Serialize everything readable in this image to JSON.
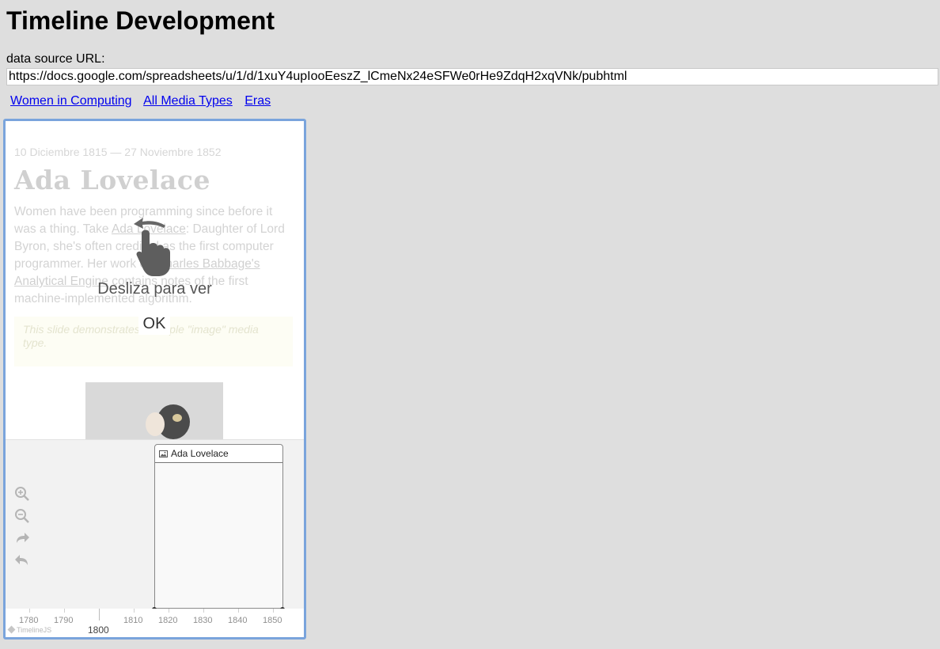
{
  "page": {
    "title": "Timeline Development",
    "url_label": "data source URL:",
    "url_value": "https://docs.google.com/spreadsheets/u/1/d/1xuY4upIooEeszZ_lCmeNx24eSFWe0rHe9ZdqH2xqVNk/pubhtml"
  },
  "nav": {
    "women_in_computing": "Women in Computing",
    "all_media_types": "All Media Types",
    "eras": "Eras"
  },
  "slide": {
    "date": "10 Diciembre 1815 — 27 Noviembre 1852",
    "headline": "Ada Lovelace",
    "text_1": "Women have been programming since before it was a thing. Take ",
    "link_ada": "Ada Lovelace",
    "text_2": ": Daughter of Lord Byron, she's often credited as the first computer programmer. Her work on ",
    "link_babbage": "Charles Babbage's Analytical Engine",
    "text_3": " contains notes of the first machine-implemented algorithm.",
    "note": "This slide demonstrates a simple \"image\" media type."
  },
  "overlay": {
    "message": "Desliza para ver",
    "ok": "OK"
  },
  "timenav": {
    "event_title": "Ada Lovelace",
    "ticks": [
      "1780",
      "1790",
      "1810",
      "1820",
      "1830",
      "1840",
      "1850"
    ],
    "major_label": "1800",
    "brand": "TimelineJS"
  }
}
